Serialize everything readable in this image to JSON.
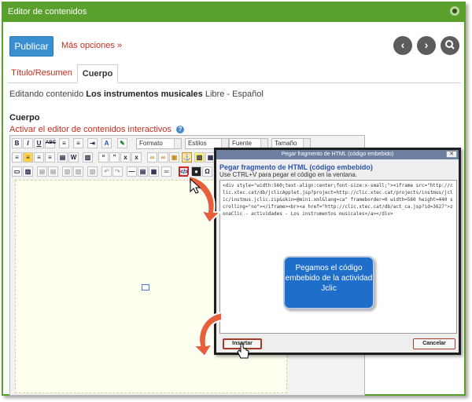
{
  "window": {
    "title": "Editor de contenidos",
    "settings_icon": "gear-icon"
  },
  "toolbar": {
    "publish_label": "Publicar",
    "more_options_label": "Más opciones »",
    "prev_symbol": "‹",
    "next_symbol": "›",
    "prev_icon": "chevron-left-icon",
    "next_icon": "chevron-right-icon",
    "search_icon": "search-icon"
  },
  "tabs": [
    {
      "label": "Título/Resumen",
      "active": false
    },
    {
      "label": "Cuerpo",
      "active": true
    }
  ],
  "editing": {
    "prefix": "Editando contenido",
    "name": "Los instrumentos musicales",
    "suffix": "Libre - Español"
  },
  "body_section": {
    "title": "Cuerpo",
    "activate_link": "Activar el editor de contenidos interactivos",
    "help_icon": "help-icon"
  },
  "editor": {
    "format_select": "Formato",
    "styles_select": "Estilos",
    "font_select": "Fuente",
    "size_select": "Tamaño",
    "row1_buttons": [
      "B",
      "I",
      "U",
      "ABC"
    ],
    "embed_icon": "embed-html-icon",
    "anchor_icon": "anchor-icon"
  },
  "dialog": {
    "header": "Pegar fragmento de HTML (código embebido)",
    "close_symbol": "✕",
    "title": "Pegar fragmento de HTML (código embebido)",
    "hint": "Use CTRL+V para pegar el código en la ventana.",
    "code": "<div style=\"width:560;text-align:center;font-size:x-small;\"><iframe src=\"http://clic.xtec.cat/db/jclicApplet.jsp?project=http://clic.xtec.cat/projects/instmus/jclic/instmus.jclic.zip&skin=@mini.xml&lang=ca\" frameborder=0 width=560 height=440 scrolling=\"no\"></iframe><br><a href=\"http://clic.xtec.cat/db/act_ca.jsp?id=3627\">zonaClic - actividades - Los instrumentos musicales</a></div>",
    "insert_label": "Insertar",
    "cancel_label": "Cancelar"
  },
  "callout": {
    "text": "Pegamos el código embebido de la actividad Jclic"
  },
  "colors": {
    "accent_green": "#5aa02c",
    "publish_blue": "#3a8fd0",
    "link_red": "#c62d1f",
    "callout_blue": "#1f6ec9",
    "highlight_red": "#d0281c"
  }
}
